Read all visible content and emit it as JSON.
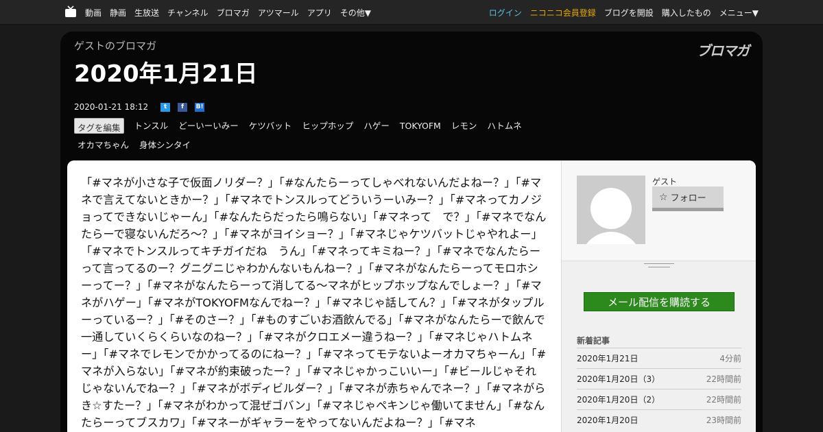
{
  "nav": {
    "left": [
      "動画",
      "静画",
      "生放送",
      "チャンネル",
      "ブロマガ",
      "アツマール",
      "アプリ",
      "その他▼"
    ],
    "login": "ログイン",
    "register": "ニコニコ会員登録",
    "start_blog": "ブログを開設",
    "purchased": "購入したもの",
    "menu": "メニュー▼"
  },
  "header": {
    "blog_name": "ゲストのブロマガ",
    "brand": "ブロマガ",
    "title": "2020年1月21日",
    "datetime": "2020-01-21 18:12",
    "share": {
      "twitter": "t",
      "facebook": "f",
      "hatena": "B!"
    },
    "edit_tags": "タグを編集",
    "tags": [
      "トンスル",
      "どーいーいみー",
      "ケツバット",
      "ヒップホップ",
      "ハゲー",
      "TOKYOFM",
      "レモン",
      "ハトムネ",
      "オカマちゃん",
      "身体シンタイ"
    ]
  },
  "article": {
    "body": "「#マネが小さな子で仮面ノリダー？」「#なんたらーってしゃべれないんだよねー？」「#マネで言えてないときかー？」「#マネでトンスルってどういうーいみー？」「#マネってカノジョってできないじゃーん」「#なんたらだったら鳴らない」「#マネって　で？」「#マネでなんたらーで寝ないんだろ〜？」「#マネがヨイショー？」「#マネじゃケツバットじゃやれよー」「#マネでトンスルってキチガイだね　うん」「#マネってキミねー？」「#マネでなんたらーって言ってるのー？グニグニじゃわかんないもんねー？」「#マネがなんたらーってモロホシーってー？」「#マネがなんたらーって消してる〜マネがヒップホップなんでしょー？」「#マネがハゲー」「#マネがTOKYOFMなんでねー？」「#マネじゃ話してん？」「#マネがタップルーっているー？」「#そのさー？」「#ものすごいお酒飲んでる」「#マネがなんたらーで飲んで一通していくらくらいなのねー？」「#マネがクロエメー違うねー？」「#マネじゃハトムネー」「#マネでレモンでかかってるのにねー？」「#マネってモテないよーオカマちゃーん」「#マネが入らない」「#マネが約束破ったー？」「#マネじゃかっこいいー」「#ビールじゃそれじゃないんでねー？」「#マネがボディビルダー？」「#マネが赤ちゃんでネー？」「#マネがらき☆すたー？」「#マネがわかって混ぜゴバン」「#マネじゃペキンじゃ働いてません」「#なんたらーってブスカワ」「#マネーがギャラーをやってないんだよねー？」「#マネ"
  },
  "sidebar": {
    "user_name": "ゲスト",
    "follow": "フォロー",
    "subscribe": "メール配信を購読する",
    "recent_title": "新着記事",
    "recent": [
      {
        "title": "2020年1月21日",
        "ago": "4分前"
      },
      {
        "title": "2020年1月20日（3）",
        "ago": "22時間前"
      },
      {
        "title": "2020年1月20日（2）",
        "ago": "22時間前"
      },
      {
        "title": "2020年1月20日",
        "ago": "23時間前"
      }
    ]
  },
  "colors": {
    "login": "#5bc0de",
    "register": "#e6a800",
    "subscribe_button": "#2c8a1d"
  }
}
